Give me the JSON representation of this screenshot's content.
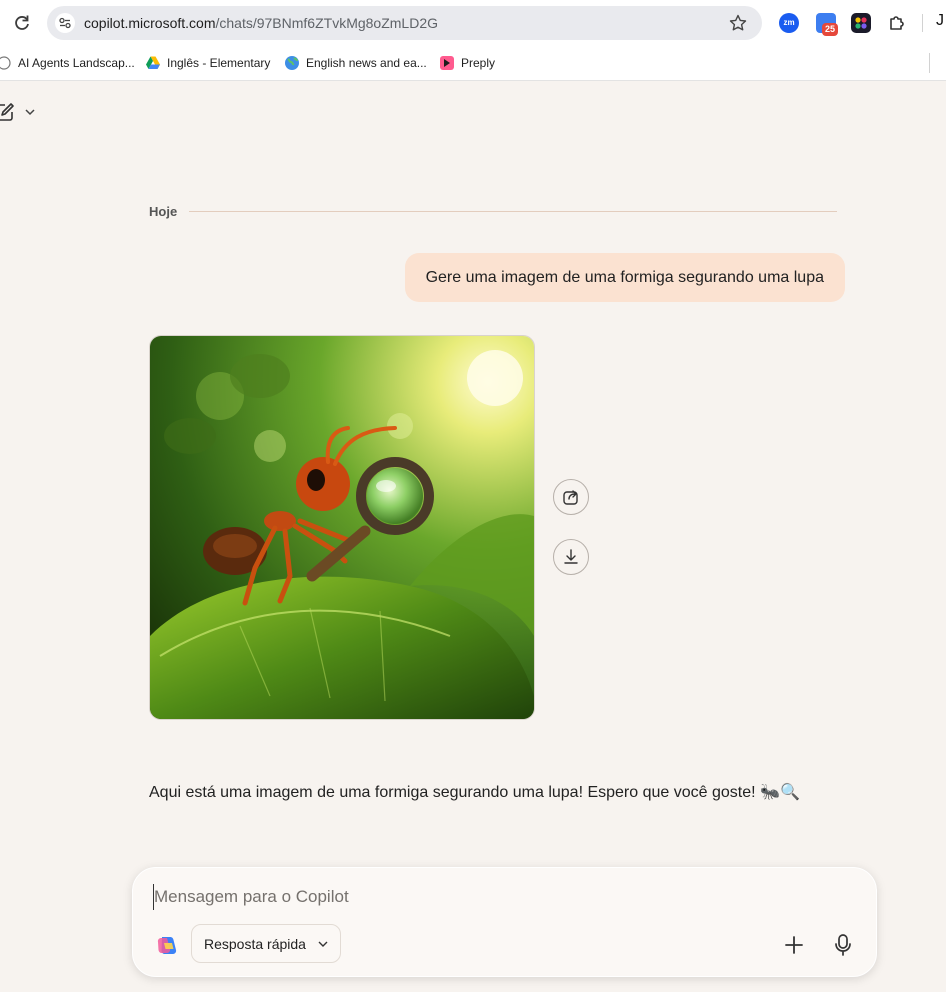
{
  "browser": {
    "url_host": "copilot.microsoft.com",
    "url_path": "/chats/97BNmf6ZTvkMg8oZmLD2G",
    "badge_count": "25",
    "zoom_ext_text": "zm",
    "profile_fragment": "J"
  },
  "bookmarks": [
    {
      "label": "AI Agents Landscap...",
      "icon": "globe-icon"
    },
    {
      "label": "Inglês - Elementary",
      "icon": "google-drive-icon"
    },
    {
      "label": "English news and ea...",
      "icon": "earth-icon"
    },
    {
      "label": "Preply",
      "icon": "preply-icon"
    }
  ],
  "chat": {
    "date_label": "Hoje",
    "user_message": "Gere uma imagem de uma formiga segurando uma lupa",
    "ai_response": "Aqui está uma imagem de uma formiga segurando uma lupa! Espero que você goste! 🐜🔍"
  },
  "composer": {
    "placeholder": "Mensagem para o Copilot",
    "value": "",
    "mode_label": "Resposta rápida"
  },
  "colors": {
    "page_bg": "#f7f3ef",
    "user_bubble": "#fbe2d1",
    "divider": "#e3cdbe"
  }
}
